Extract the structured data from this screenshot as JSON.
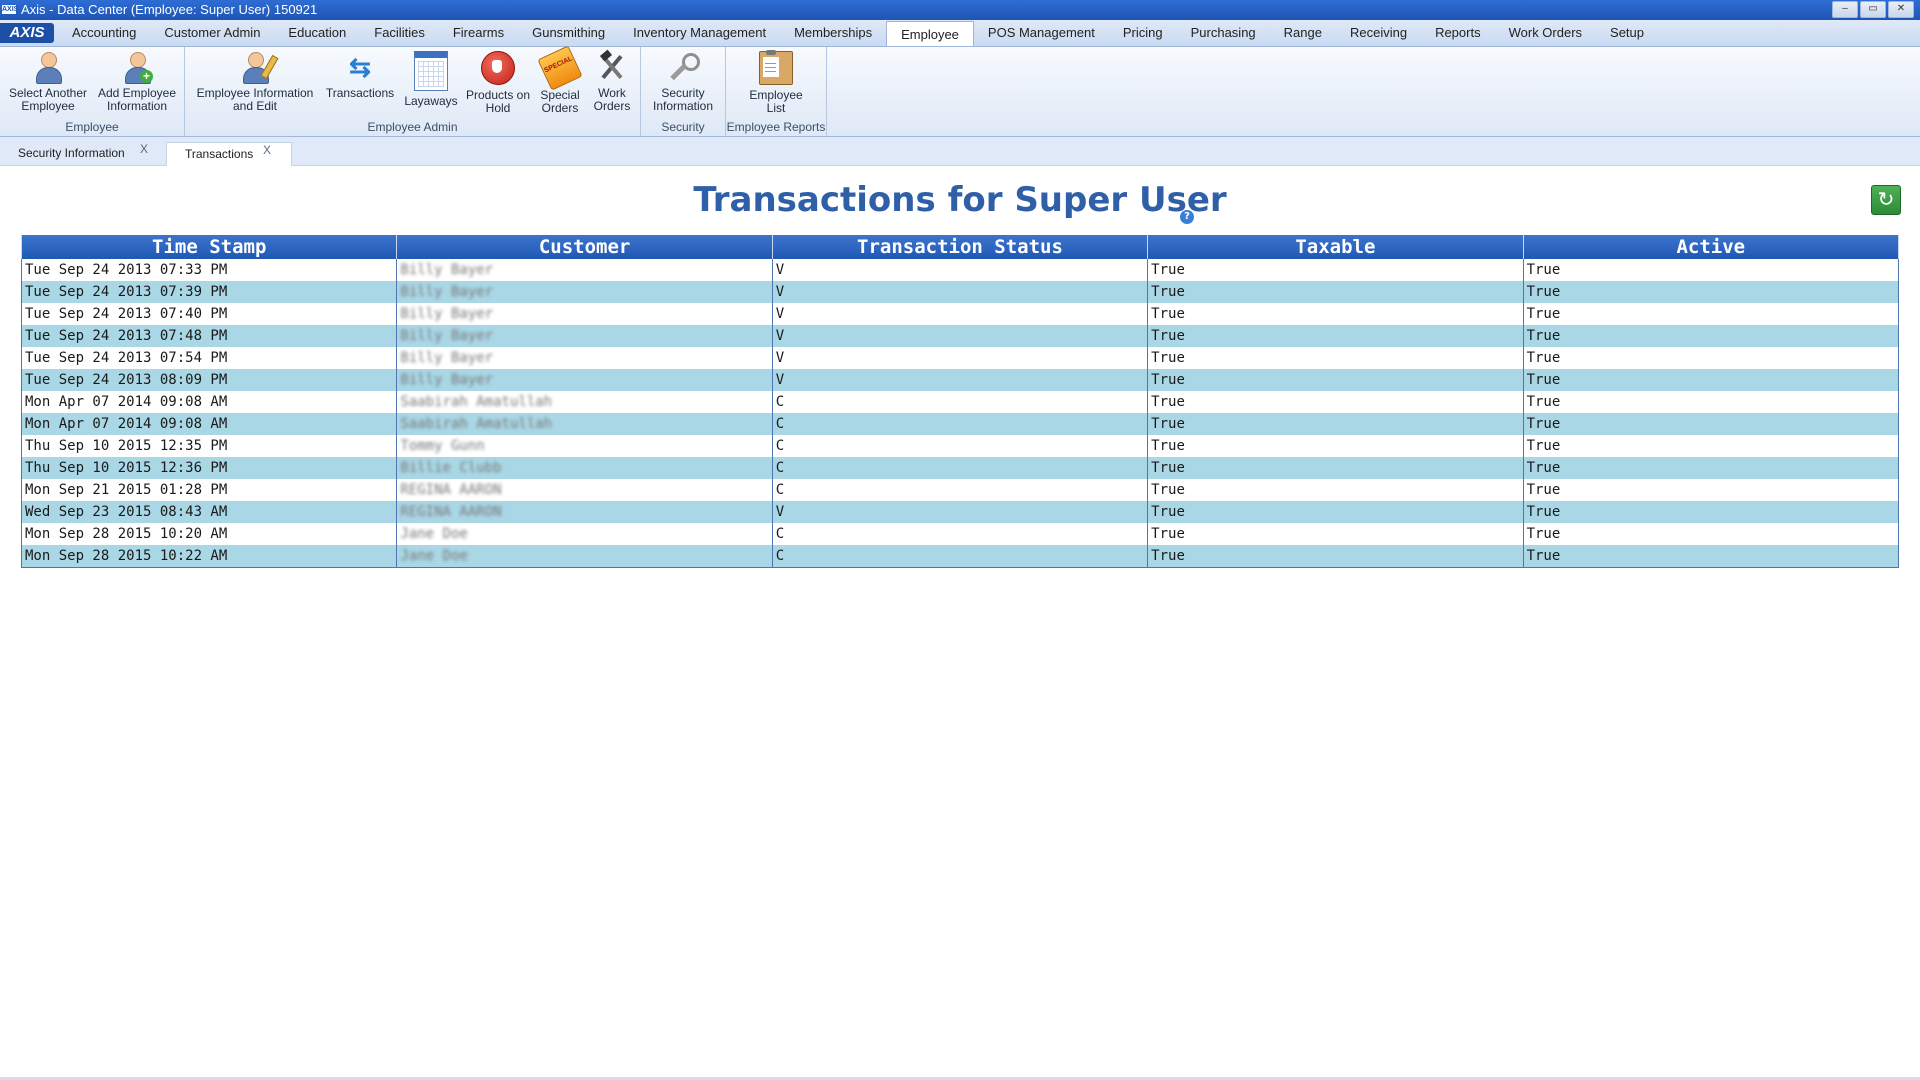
{
  "window": {
    "title": "Axis - Data Center  (Employee: Super User) 150921",
    "app_icon_text": "AXIS",
    "controls": [
      "–",
      "▭",
      "✕"
    ]
  },
  "menu": {
    "logo": "AXIS",
    "items": [
      "Accounting",
      "Customer Admin",
      "Education",
      "Facilities",
      "Firearms",
      "Gunsmithing",
      "Inventory Management",
      "Memberships",
      "Employee",
      "POS Management",
      "Pricing",
      "Purchasing",
      "Range",
      "Receiving",
      "Reports",
      "Work Orders",
      "Setup"
    ],
    "active": "Employee"
  },
  "ribbon": {
    "groups": {
      "employee": {
        "label": "Employee",
        "select_another": [
          "Select Another",
          "Employee"
        ],
        "add_employee": [
          "Add Employee",
          "Information"
        ]
      },
      "employee_admin": {
        "label": "Employee Admin",
        "info_edit": [
          "Employee Information",
          "and Edit"
        ],
        "transactions": [
          "Transactions",
          ""
        ],
        "layaways": [
          "Layaways",
          ""
        ],
        "products_on_hold": [
          "Products on",
          "Hold"
        ],
        "special_orders": [
          "Special",
          "Orders"
        ],
        "work_orders": [
          "Work",
          "Orders"
        ]
      },
      "security": {
        "label": "Security",
        "security_info": [
          "Security",
          "Information"
        ]
      },
      "employee_reports": {
        "label": "Employee Reports",
        "employee_list": [
          "Employee",
          "List"
        ]
      }
    },
    "special_tag_text": "SPECIAL"
  },
  "doc_tabs": [
    {
      "label": "Security Information",
      "close": "X"
    },
    {
      "label": "Transactions",
      "close": "X"
    }
  ],
  "main": {
    "title": "Transactions for Super User",
    "help": "?",
    "refresh": "↻"
  },
  "table": {
    "columns": [
      "Time Stamp",
      "Customer",
      "Transaction Status",
      "Taxable",
      "Active"
    ],
    "rows": [
      [
        "Tue Sep 24 2013 07:33 PM",
        "Billy Bayer",
        "V",
        "True",
        "True"
      ],
      [
        "Tue Sep 24 2013 07:39 PM",
        "Billy Bayer",
        "V",
        "True",
        "True"
      ],
      [
        "Tue Sep 24 2013 07:40 PM",
        "Billy Bayer",
        "V",
        "True",
        "True"
      ],
      [
        "Tue Sep 24 2013 07:48 PM",
        "Billy Bayer",
        "V",
        "True",
        "True"
      ],
      [
        "Tue Sep 24 2013 07:54 PM",
        "Billy Bayer",
        "V",
        "True",
        "True"
      ],
      [
        "Tue Sep 24 2013 08:09 PM",
        "Billy Bayer",
        "V",
        "True",
        "True"
      ],
      [
        "Mon Apr 07 2014 09:08 AM",
        "Saabirah Amatullah",
        "C",
        "True",
        "True"
      ],
      [
        "Mon Apr 07 2014 09:08 AM",
        "Saabirah Amatullah",
        "C",
        "True",
        "True"
      ],
      [
        "Thu Sep 10 2015 12:35 PM",
        "Tommy Gunn",
        "C",
        "True",
        "True"
      ],
      [
        "Thu Sep 10 2015 12:36 PM",
        "Billie Clubb",
        "C",
        "True",
        "True"
      ],
      [
        "Mon Sep 21 2015 01:28 PM",
        "REGINA AARON",
        "C",
        "True",
        "True"
      ],
      [
        "Wed Sep 23 2015 08:43 AM",
        "REGINA AARON",
        "V",
        "True",
        "True"
      ],
      [
        "Mon Sep 28 2015 10:20 AM",
        "Jane Doe",
        "C",
        "True",
        "True"
      ],
      [
        "Mon Sep 28 2015 10:22 AM",
        "Jane Doe",
        "C",
        "True",
        "True"
      ]
    ]
  },
  "colors": {
    "header_blue": "#2a63bf",
    "title_blue": "#2f5fa7",
    "row_alt": "#a9d7e6",
    "refresh_green": "#3a9c45"
  }
}
